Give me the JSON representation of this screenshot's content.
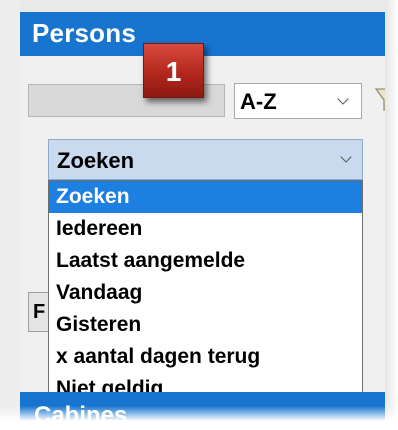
{
  "header": {
    "title": "Persons"
  },
  "callout": {
    "number": "1",
    "color": "#b2271d"
  },
  "sort": {
    "selected": "A-Z"
  },
  "search": {
    "selected": "Zoeken",
    "options": [
      "Zoeken",
      "Iedereen",
      "Laatst aangemelde",
      "Vandaag",
      "Gisteren",
      "x aantal dagen terug",
      "Niet geldig"
    ]
  },
  "left_button": {
    "label": "F"
  },
  "footer": {
    "section_title": "Cabines"
  },
  "colors": {
    "accent": "#1875cf",
    "selection": "#1d7fdf",
    "combo_bg": "#c9daee"
  },
  "icons": [
    "chevron-down-icon",
    "filter-icon"
  ]
}
